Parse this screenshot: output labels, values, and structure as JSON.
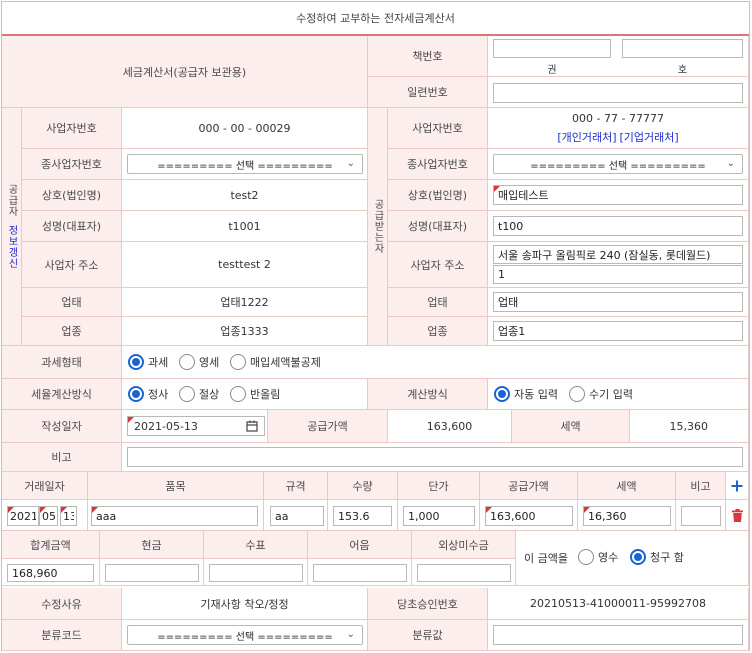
{
  "title": "수정하여 교부하는 전자세금계산서",
  "colors": {
    "label_bg": "#fdeeee",
    "border": "#ecc8c8",
    "accent_red": "#d9363e",
    "link_blue": "#1d2bcb",
    "radio_blue": "#1a63d6"
  },
  "header": {
    "doc_label": "세금계산서(공급자 보관용)",
    "book_no_label": "책번호",
    "book_volume_unit": "권",
    "book_number_unit": "호",
    "serial_label": "일련번호"
  },
  "supplier": {
    "side_label": "공급자",
    "update_link": "정보갱신",
    "reg_no_label": "사업자번호",
    "reg_no": "000 - 00 - 00029",
    "sub_no_label": "종사업자번호",
    "sub_no_select": "========= 선택 =========",
    "name_label": "상호(법인명)",
    "name": "test2",
    "ceo_label": "성명(대표자)",
    "ceo": "t1001",
    "addr_label": "사업자 주소",
    "addr": "testtest 2",
    "biz_type_label": "업태",
    "biz_type": "업태1222",
    "biz_item_label": "업종",
    "biz_item": "업종1333"
  },
  "buyer": {
    "side_label": "공급받는자",
    "reg_no_label": "사업자번호",
    "reg_no": "000 - 77 - 77777",
    "personal_link": "[개인거래처]",
    "company_link": "[기업거래처]",
    "sub_no_label": "종사업자번호",
    "sub_no_select": "========= 선택 =========",
    "name_label": "상호(법인명)",
    "name": "매입테스트",
    "ceo_label": "성명(대표자)",
    "ceo": "t100",
    "addr_label": "사업자 주소",
    "addr1": "서울 송파구 올림픽로 240 (잠실동, 롯데월드)",
    "addr2": "1",
    "biz_type_label": "업태",
    "biz_type": "업태",
    "biz_item_label": "업종",
    "biz_item": "업종1"
  },
  "tax_type": {
    "label": "과세형태",
    "options": [
      "과세",
      "영세",
      "매입세액불공제"
    ]
  },
  "issue_type": {
    "label": "세율계산방식",
    "options": [
      "정사",
      "절상",
      "반올림"
    ]
  },
  "calc_type": {
    "label": "계산방식",
    "options": [
      "자동 입력",
      "수기 입력"
    ]
  },
  "amounts": {
    "date_label": "작성일자",
    "date": "2021-05-13",
    "supply_label": "공급가액",
    "supply": "163,600",
    "tax_label": "세액",
    "tax": "15,360"
  },
  "remark": {
    "label": "비고",
    "value": ""
  },
  "items": {
    "headers": [
      "거래일자",
      "품목",
      "규격",
      "수량",
      "단가",
      "공급가액",
      "세액",
      "비고"
    ],
    "rows": [
      {
        "year": "2021",
        "month": "05",
        "day": "13",
        "name": "aaa",
        "spec": "aa",
        "qty": "153.6",
        "price": "1,000",
        "supply": "163,600",
        "tax": "16,360",
        "note": ""
      }
    ]
  },
  "totals": {
    "headers": [
      "합계금액",
      "현금",
      "수표",
      "어음",
      "외상미수금"
    ],
    "values": [
      "168,960",
      "",
      "",
      "",
      ""
    ],
    "receipt_label": "이 금액을",
    "receipt_options": [
      "영수",
      "청구 함"
    ]
  },
  "footer": {
    "reason_label": "수정사유",
    "reason": "기재사항 착오/정정",
    "orig_approval_label": "당초승인번호",
    "orig_approval": "20210513-41000011-95992708",
    "category_code_label": "분류코드",
    "category_code_select": "========= 선택 =========",
    "category_value_label": "분류값"
  }
}
